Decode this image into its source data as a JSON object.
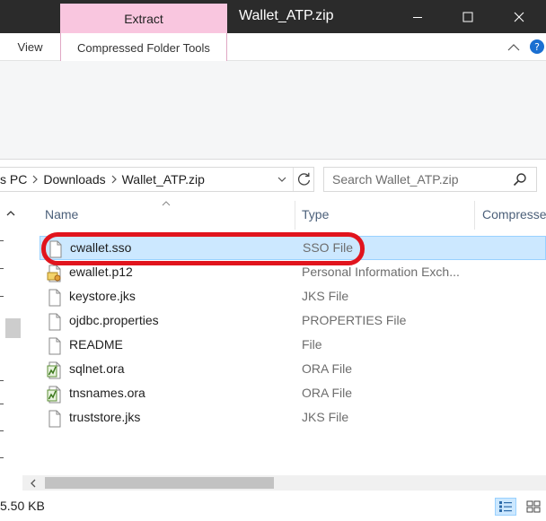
{
  "window": {
    "title": "Wallet_ATP.zip",
    "context_tab": "Extract"
  },
  "ribbon": {
    "tabs": [
      {
        "label": "View"
      },
      {
        "label": "Compressed Folder Tools"
      }
    ]
  },
  "address": {
    "crumbs": [
      "s PC",
      "Downloads",
      "Wallet_ATP.zip"
    ]
  },
  "search": {
    "placeholder": "Search Wallet_ATP.zip"
  },
  "columns": {
    "name": "Name",
    "type": "Type",
    "compressed": "Compresse"
  },
  "files": [
    {
      "name": "cwallet.sso",
      "type": "SSO File",
      "icon": "blank-file-icon",
      "selected": true
    },
    {
      "name": "ewallet.p12",
      "type": "Personal Information Exch...",
      "icon": "certificate-file-icon"
    },
    {
      "name": "keystore.jks",
      "type": "JKS File",
      "icon": "blank-file-icon"
    },
    {
      "name": "ojdbc.properties",
      "type": "PROPERTIES File",
      "icon": "blank-file-icon"
    },
    {
      "name": "README",
      "type": "File",
      "icon": "blank-file-icon"
    },
    {
      "name": "sqlnet.ora",
      "type": "ORA File",
      "icon": "ora-file-icon"
    },
    {
      "name": "tnsnames.ora",
      "type": "ORA File",
      "icon": "ora-file-icon"
    },
    {
      "name": "truststore.jks",
      "type": "JKS File",
      "icon": "blank-file-icon"
    }
  ],
  "status": {
    "size": "5.50 KB"
  },
  "colors": {
    "extract_tab": "#f9c6df",
    "selection": "#cce8ff",
    "highlight_ring": "#e1141d"
  }
}
